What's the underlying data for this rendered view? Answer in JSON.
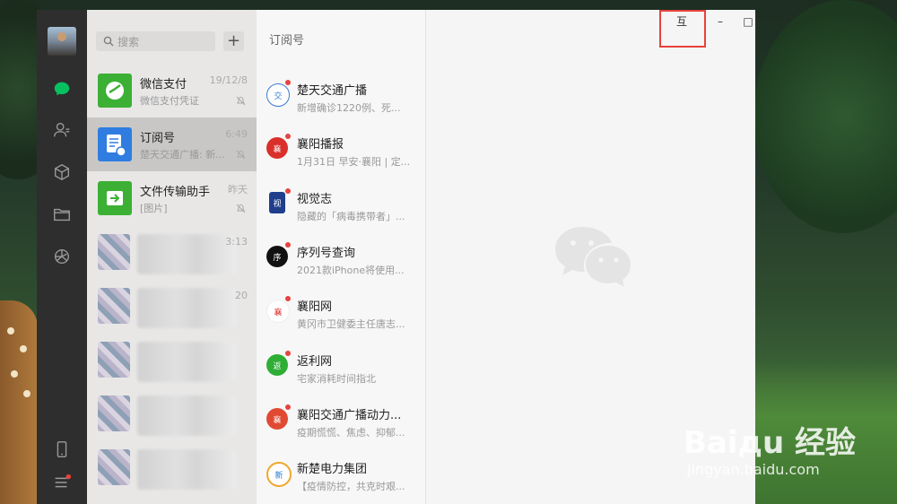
{
  "search": {
    "placeholder": "搜索",
    "add_label": "+"
  },
  "chats": [
    {
      "name": "微信支付",
      "preview": "微信支付凭证",
      "time": "19/12/8",
      "color": "#3cb035"
    },
    {
      "name": "订阅号",
      "preview": "楚天交通广播: 新...",
      "time": "6:49",
      "color": "#2f7de1"
    },
    {
      "name": "文件传输助手",
      "preview": "[图片]",
      "time": "昨天",
      "color": "#3cb035"
    },
    {
      "time": "3:13"
    },
    {
      "time": "20"
    }
  ],
  "subscriptions": {
    "title": "订阅号",
    "items": [
      {
        "name": "楚天交通广播",
        "preview": "新增确诊1220例、死..."
      },
      {
        "name": "襄阳播报",
        "preview": "1月31日 早安·襄阳 | 定..."
      },
      {
        "name": "视觉志",
        "preview": "隐藏的「病毒携带者」..."
      },
      {
        "name": "序列号查询",
        "preview": "2021款iPhone将使用..."
      },
      {
        "name": "襄阳网",
        "preview": "黄冈市卫健委主任唐志..."
      },
      {
        "name": "返利网",
        "preview": "宅家消耗时间指北"
      },
      {
        "name": "襄阳交通广播动力...",
        "preview": "疫期慌慌、焦虑、抑郁..."
      },
      {
        "name": "新楚电力集团",
        "preview": "【疫情防控，共克时艰..."
      }
    ]
  },
  "window_controls": {
    "pin": "互",
    "minimize": "–",
    "maximize": "□",
    "close": "✕"
  },
  "watermark": {
    "logo": "Baiдu 经验",
    "url": "jingyan.baidu.com"
  },
  "colors": {
    "accent_green": "#07c160",
    "highlight_red": "#e8413b"
  }
}
